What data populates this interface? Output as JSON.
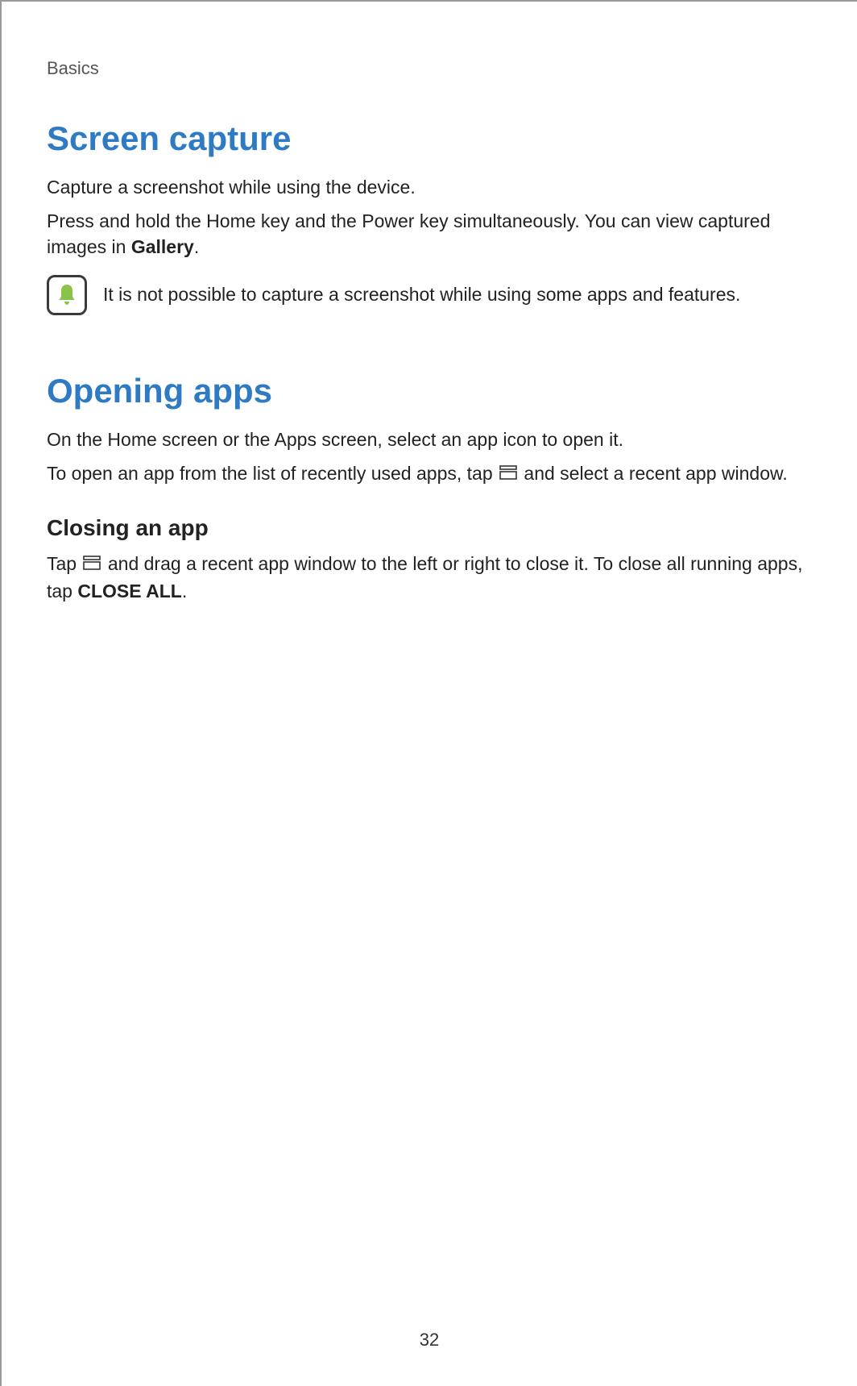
{
  "section_label": "Basics",
  "sections": {
    "screen_capture": {
      "heading": "Screen capture",
      "p1": "Capture a screenshot while using the device.",
      "p2_pre": "Press and hold the Home key and the Power key simultaneously. You can view captured images in ",
      "p2_bold": "Gallery",
      "p2_post": ".",
      "note": "It is not possible to capture a screenshot while using some apps and features."
    },
    "opening_apps": {
      "heading": "Opening apps",
      "p1": "On the Home screen or the Apps screen, select an app icon to open it.",
      "p2_pre": "To open an app from the list of recently used apps, tap ",
      "p2_post": " and select a recent app window.",
      "subheading": "Closing an app",
      "p3_pre": "Tap ",
      "p3_mid": " and drag a recent app window to the left or right to close it. To close all running apps, tap ",
      "p3_bold": "CLOSE ALL",
      "p3_post": "."
    }
  },
  "page_number": "32"
}
